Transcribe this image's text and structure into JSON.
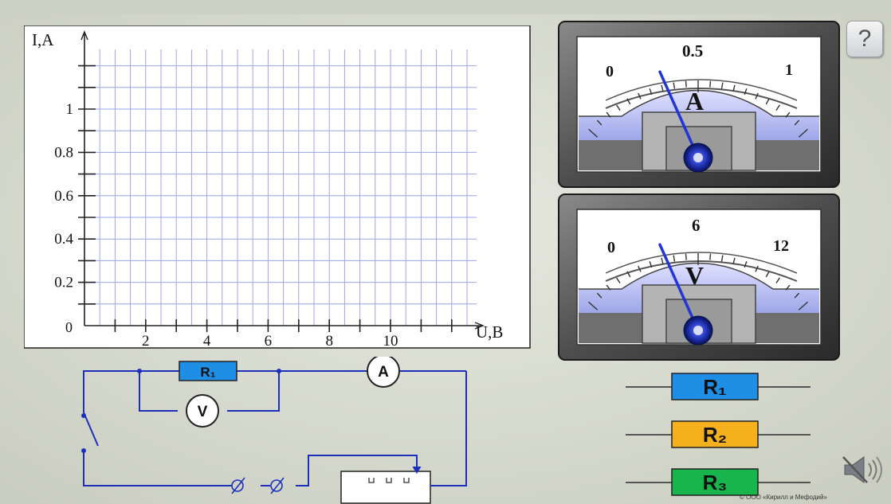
{
  "graph": {
    "y_axis_label": "I,A",
    "x_axis_label": "U,B",
    "origin_label": "0",
    "y_tick_labels": [
      "0.2",
      "0.4",
      "0.6",
      "0.8",
      "1"
    ],
    "x_tick_labels": [
      "2",
      "4",
      "6",
      "8",
      "10"
    ]
  },
  "ammeter": {
    "scale_labels": [
      "0",
      "0.5",
      "1"
    ],
    "unit_letter": "A",
    "reading": 0.25,
    "max": 1
  },
  "voltmeter": {
    "scale_labels": [
      "0",
      "6",
      "12"
    ],
    "unit_letter": "V",
    "reading": 3,
    "max": 12
  },
  "circuit": {
    "resistor_label": "R₁",
    "voltmeter_symbol": "V",
    "ammeter_symbol": "A"
  },
  "resistors": [
    {
      "label": "R₁",
      "color": "#1f8fe6"
    },
    {
      "label": "R₂",
      "color": "#f5b01e"
    },
    {
      "label": "R₃",
      "color": "#17b54b"
    }
  ],
  "help": {
    "label": "?"
  },
  "sound": {
    "icon": "speaker-muted-icon"
  },
  "copyright": "© ООО «Кирилл и Мефодий»"
}
